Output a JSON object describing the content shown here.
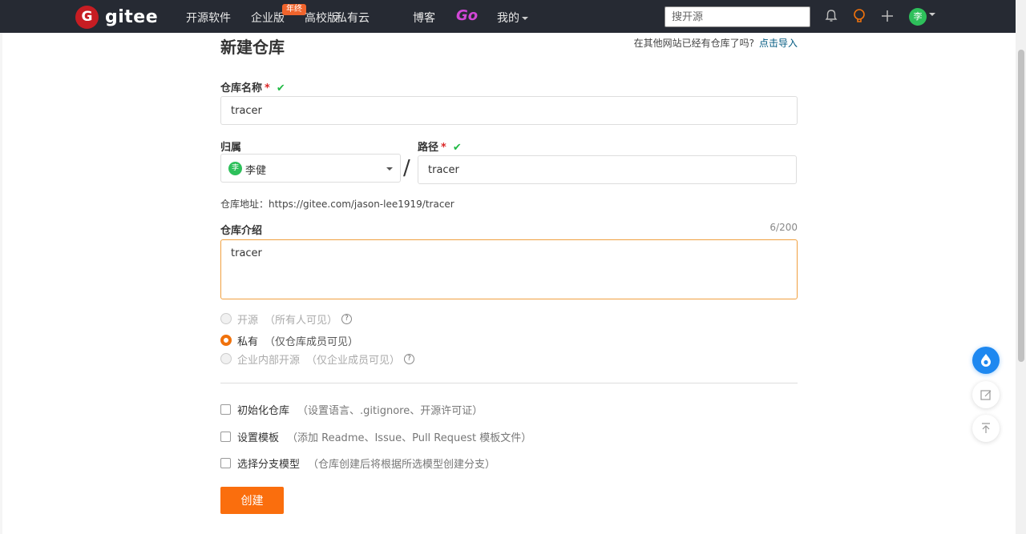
{
  "brand": {
    "name": "gitee",
    "mark": "G"
  },
  "nav": {
    "items": [
      "开源软件",
      "企业版",
      "高校版",
      "私有云",
      "博客",
      "Go",
      "我的"
    ],
    "badge": "年终",
    "search_placeholder": "搜开源"
  },
  "user": {
    "avatar_text": "李"
  },
  "form": {
    "title": "新建仓库",
    "import_prompt": "在其他网站已经有仓库了吗?",
    "import_link": "点击导入",
    "name_label": "仓库名称",
    "name_value": "tracer",
    "owner_label": "归属",
    "owner_name": "李健",
    "path_label": "路径",
    "path_value": "tracer",
    "address": "仓库地址：https://gitee.com/jason-lee1919/tracer",
    "desc_label": "仓库介绍",
    "desc_counter": "6/200",
    "desc_value": "tracer",
    "visibility": [
      {
        "label": "开源",
        "hint": "（所有人可见）",
        "selected": false,
        "disabled": true,
        "help": true
      },
      {
        "label": "私有",
        "hint": "（仅仓库成员可见）",
        "selected": true,
        "disabled": false,
        "help": false
      },
      {
        "label": "企业内部开源",
        "hint": "（仅企业成员可见）",
        "selected": false,
        "disabled": true,
        "help": true
      }
    ],
    "options": [
      {
        "label": "初始化仓库",
        "hint": "（设置语言、.gitignore、开源许可证）"
      },
      {
        "label": "设置模板",
        "hint": "（添加 Readme、Issue、Pull Request 模板文件）"
      },
      {
        "label": "选择分支模型",
        "hint": "（仓库创建后将根据所选模型创建分支）"
      }
    ],
    "submit_label": "创建"
  },
  "colors": {
    "accent": "#fa6e0d",
    "nav_bg": "#262a33",
    "link": "#005980",
    "check": "#21ba45"
  }
}
